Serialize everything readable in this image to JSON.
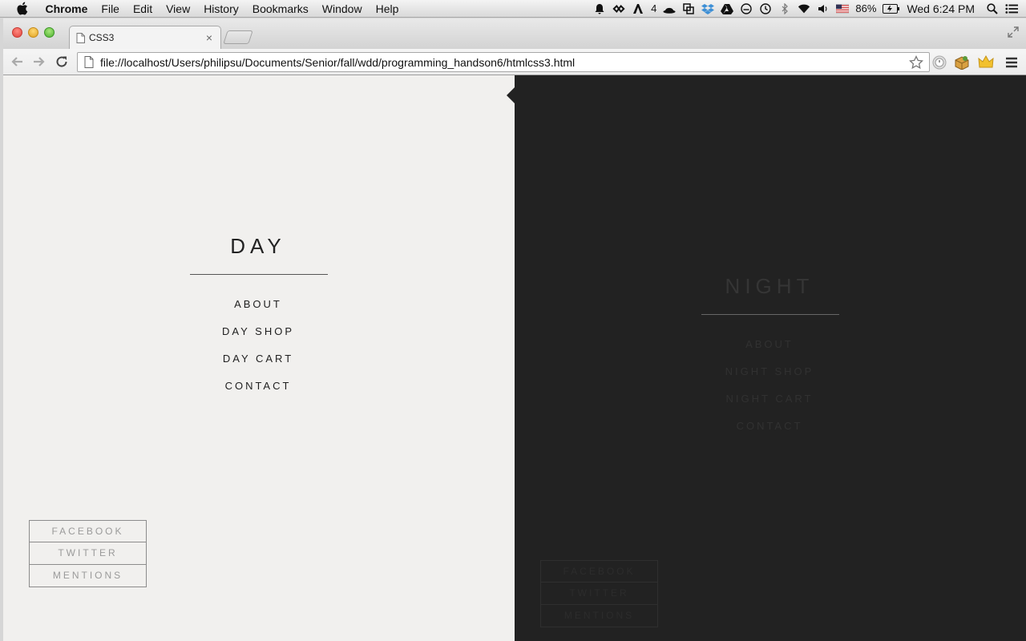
{
  "menubar": {
    "app_name": "Chrome",
    "items": [
      "File",
      "Edit",
      "View",
      "History",
      "Bookmarks",
      "Window",
      "Help"
    ],
    "tray": {
      "adobe_count": "4",
      "battery": "86%",
      "clock": "Wed 6:24 PM"
    }
  },
  "browser": {
    "tab_title": "CSS3",
    "tab_close": "×",
    "url": "file://localhost/Users/philipsu/Documents/Senior/fall/wdd/programming_handson6/htmlcss3.html"
  },
  "page": {
    "day": {
      "title": "DAY",
      "nav": [
        "ABOUT",
        "DAY SHOP",
        "DAY CART",
        "CONTACT"
      ],
      "social": [
        "FACEBOOK",
        "TWITTER",
        "MENTIONS"
      ],
      "background": "#f1f0ee"
    },
    "night": {
      "title": "NIGHT",
      "nav": [
        "ABOUT",
        "NIGHT SHOP",
        "NIGHT CART",
        "CONTACT"
      ],
      "social": [
        "FACEBOOK",
        "TWITTER",
        "MENTIONS"
      ],
      "background": "#222222"
    }
  }
}
